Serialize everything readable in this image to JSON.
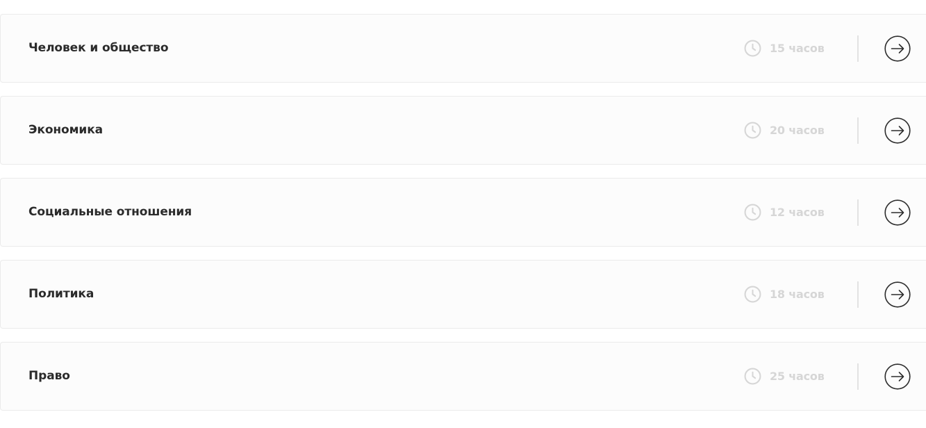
{
  "courses": [
    {
      "title": "Человек и общество",
      "duration": "15 часов",
      "icon": "clock-icon",
      "action_icon": "arrow-right-circle-icon"
    },
    {
      "title": "Экономика",
      "duration": "20 часов",
      "icon": "clock-icon",
      "action_icon": "arrow-right-circle-icon"
    },
    {
      "title": "Социальные отношения",
      "duration": "12 часов",
      "icon": "clock-icon",
      "action_icon": "arrow-right-circle-icon"
    },
    {
      "title": "Политика",
      "duration": "18 часов",
      "icon": "clock-icon",
      "action_icon": "arrow-right-circle-icon"
    },
    {
      "title": "Право",
      "duration": "25 часов",
      "icon": "clock-icon",
      "action_icon": "arrow-right-circle-icon"
    }
  ],
  "colors": {
    "title": "#2b2b2b",
    "duration": "#d6d6d6",
    "row_background": "#fcfcfc",
    "row_border": "#ebebeb",
    "arrow": "#2b2b2b"
  }
}
